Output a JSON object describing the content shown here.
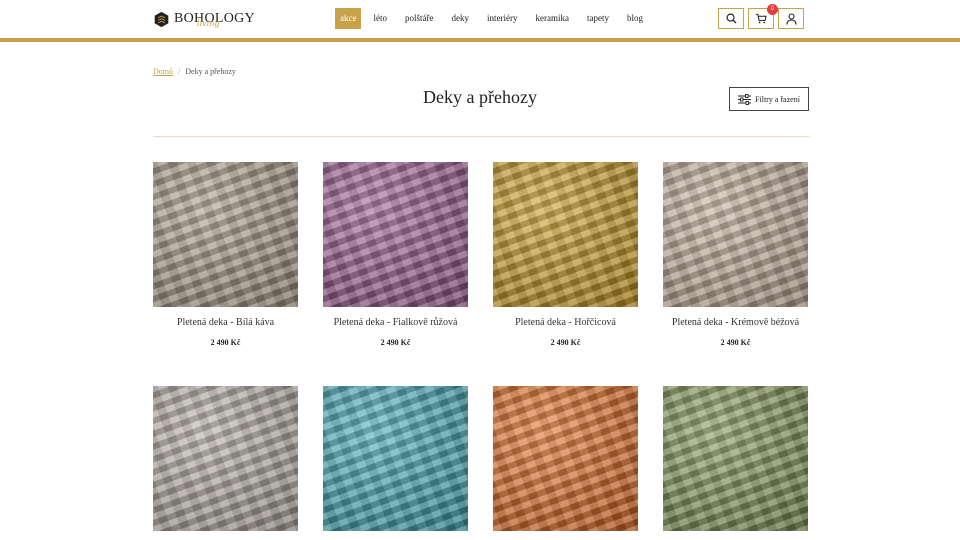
{
  "brand": {
    "name": "BOHOLOGY",
    "tagline": "living"
  },
  "nav": {
    "items": [
      "akce",
      "léto",
      "polštáře",
      "deky",
      "interiéry",
      "keramika",
      "tapety",
      "blog"
    ],
    "active": "akce"
  },
  "header": {
    "cart_count": "0",
    "icons": [
      "search-icon",
      "cart-icon",
      "user-icon"
    ]
  },
  "breadcrumb": {
    "home": "Domů",
    "current": "Deky a přehozy"
  },
  "page": {
    "title": "Deky a přehozy",
    "filter_label": "Filtry a řazení"
  },
  "colors": {
    "accent": "#c9a14a",
    "badge": "#e63b3b"
  },
  "products": [
    {
      "name": "Pletená deka - Bílá káva",
      "price": "2 490 Kč",
      "color": "#a89a86"
    },
    {
      "name": "Pletená deka - Fialkově růžová",
      "price": "2 490 Kč",
      "color": "#9a5a8f"
    },
    {
      "name": "Pletená deka - Hořčicová",
      "price": "2 490 Kč",
      "color": "#c99a1e"
    },
    {
      "name": "Pletená deka - Krémově béžová",
      "price": "2 490 Kč",
      "color": "#c4ac98"
    },
    {
      "name": "",
      "price": "",
      "color": "#b4aca5"
    },
    {
      "name": "",
      "price": "",
      "color": "#3fa7b4"
    },
    {
      "name": "",
      "price": "",
      "color": "#e06a1e"
    },
    {
      "name": "",
      "price": "",
      "color": "#7f9355"
    }
  ]
}
